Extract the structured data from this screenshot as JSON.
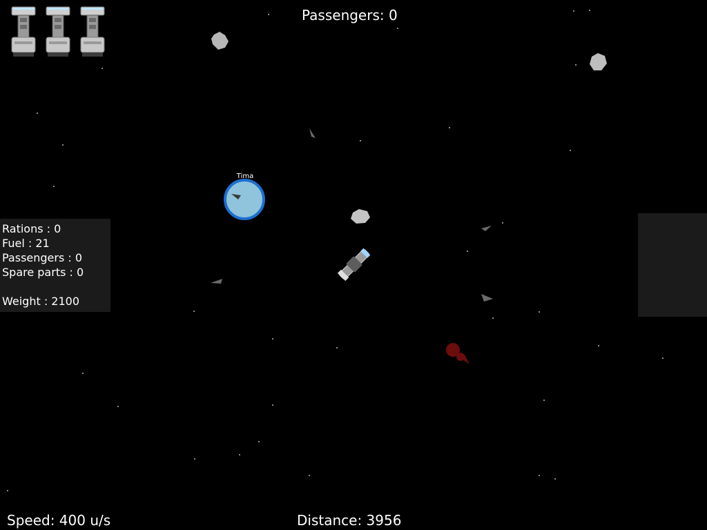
{
  "hud": {
    "passengers_top": "Passengers: 0",
    "speed": "Speed: 400 u/s",
    "distance": "Distance: 3956"
  },
  "stats": {
    "rations": "Rations : 0",
    "fuel": "Fuel : 21",
    "passengers": "Passengers : 0",
    "spare_parts": "Spare parts : 0",
    "weight": "Weight : 2100"
  },
  "planet": {
    "name": "Tima"
  },
  "lives": {
    "count": 3,
    "icon": "ship-icon"
  },
  "colors": {
    "background": "#000000",
    "panel": "#1b1b1b",
    "planet_fill": "#8fc4dc",
    "planet_ring": "#1e6fd0",
    "enemy_red": "#6b0d0d"
  }
}
